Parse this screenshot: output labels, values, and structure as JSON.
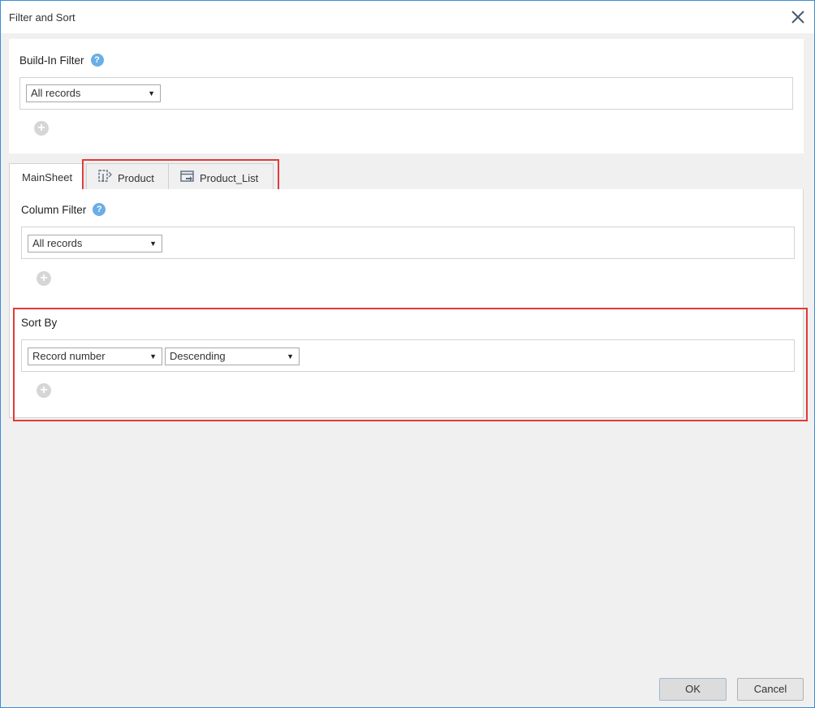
{
  "window": {
    "title": "Filter and Sort"
  },
  "builtin_filter": {
    "label": "Build-In Filter",
    "select_value": "All records"
  },
  "tabs": [
    {
      "label": "MainSheet"
    },
    {
      "label": "Product"
    },
    {
      "label": "Product_List"
    }
  ],
  "column_filter": {
    "label": "Column Filter",
    "select_value": "All records"
  },
  "sort_by": {
    "label": "Sort By",
    "field_value": "Record number",
    "order_value": "Descending"
  },
  "footer": {
    "ok_label": "OK",
    "cancel_label": "Cancel"
  },
  "icons": {
    "help": "?",
    "add": "+",
    "dropdown": "▼"
  },
  "colors": {
    "accent_border": "#3c8dd6",
    "highlight": "#e23a3a",
    "help_icon": "#6aaee6"
  }
}
